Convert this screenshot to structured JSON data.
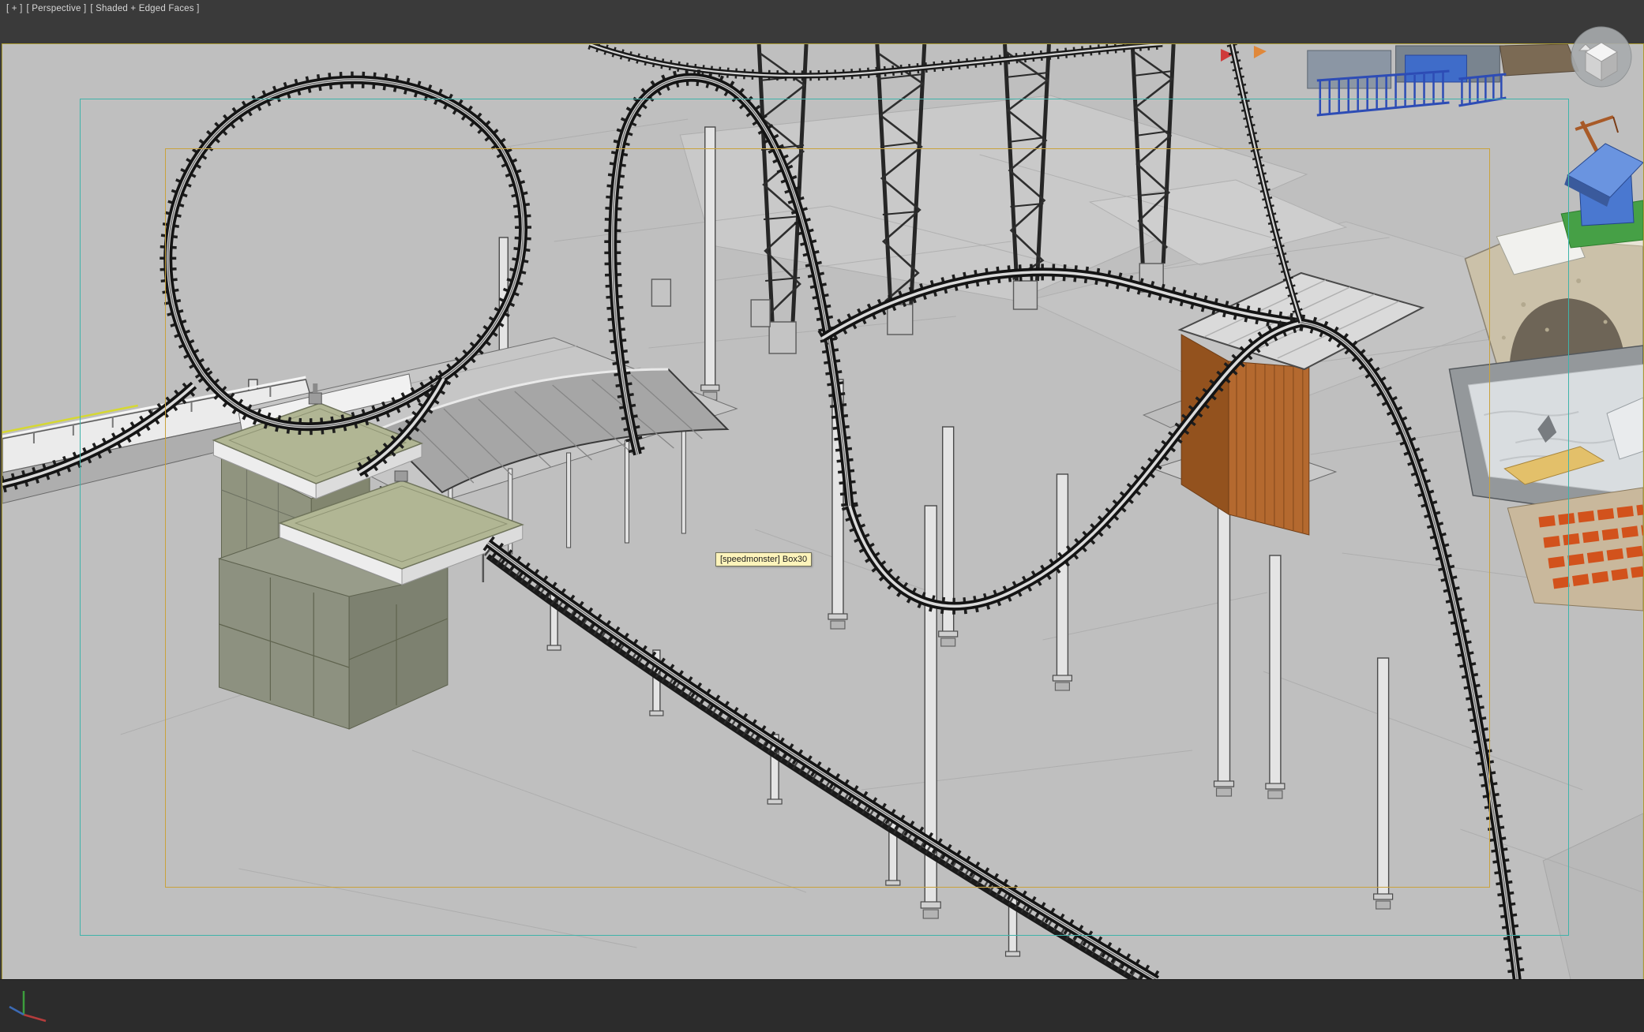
{
  "viewport": {
    "menus": [
      "[ + ]",
      "[ Perspective ]",
      "[ Shaded + Edged Faces ]"
    ]
  },
  "tooltip": {
    "text": "[speedmonster] Box30"
  },
  "scene": {
    "objects": [
      "roller-coaster-track",
      "left-turnaround-loop",
      "center-loop",
      "truss-towers",
      "support-columns",
      "station-platform",
      "station-canopy",
      "bunker-buildings",
      "wooden-shed",
      "stone-arch",
      "wave-pool",
      "grandstand-seats",
      "blue-house",
      "perimeter-fence"
    ]
  },
  "colors": {
    "viewport_bg": "#bfbfbf",
    "frame_bg": "#3a3a3a",
    "safe_frame_outer": "#3fb3aa",
    "safe_frame_inner": "#c9a23c",
    "active_viewport_border": "#ab9b32",
    "tooltip_bg": "#fdf4bb",
    "tooltip_border": "#72725a",
    "track_color": "#141414",
    "seat_color": "#d2521c",
    "shed_color": "#b4692f"
  },
  "icons": {
    "viewcube": "viewcube-icon",
    "axis_tripod": "axis-tripod-icon"
  }
}
